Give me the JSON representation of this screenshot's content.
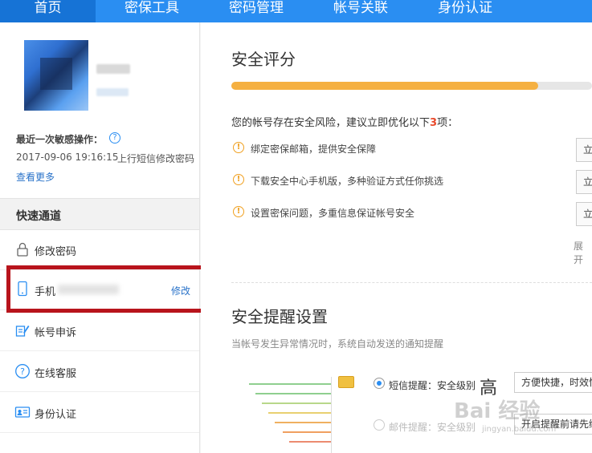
{
  "nav": {
    "items": [
      "首页",
      "密保工具",
      "密码管理",
      "帐号关联",
      "身份认证"
    ],
    "active_index": 0
  },
  "sidebar": {
    "sensitive_label": "最近一次敏感操作：",
    "sensitive_time": "2017-09-06 19:16:15",
    "sensitive_desc": "上行短信修改密码",
    "more_link": "查看更多",
    "quick_title": "快速通道",
    "quick_items": [
      {
        "label": "修改密码",
        "icon": "lock-icon"
      },
      {
        "label": "手机",
        "icon": "phone-icon",
        "action": "修改"
      },
      {
        "label": "帐号申诉",
        "icon": "edit-icon"
      },
      {
        "label": "在线客服",
        "icon": "question-icon"
      },
      {
        "label": "身份认证",
        "icon": "id-card-icon"
      }
    ]
  },
  "security": {
    "title": "安全评分",
    "score_fraction": 0.85,
    "risk_prefix": "您的帐号存在安全风险，建议立即优化以下",
    "risk_count": "3",
    "risk_suffix": "项：",
    "risk_items": [
      {
        "text": "绑定密保邮箱，提供安全保障",
        "button": "立"
      },
      {
        "text": "下载安全中心手机版，多种验证方式任你挑选",
        "button": "立"
      },
      {
        "text": "设置密保问题，多重信息保证帐号安全",
        "button": "立"
      }
    ],
    "expand": "展开"
  },
  "reminder": {
    "title": "安全提醒设置",
    "subtitle": "当帐号发生异常情况时，系统自动发送的通知提醒",
    "options": [
      {
        "label": "短信提醒：安全级别",
        "level": "高",
        "tip": "方便快捷，时效性高",
        "selected": true
      },
      {
        "label": "邮件提醒：安全级别",
        "level": "",
        "tip": "开启提醒前请先绑定",
        "selected": false
      }
    ]
  },
  "watermark": {
    "text": "Bai 经验",
    "sub": "jingyan.baidu.com"
  },
  "colors": {
    "accent": "#2a8ef2",
    "score": "#f5b041",
    "highlight": "#b8141c",
    "warn": "#f0a020"
  }
}
